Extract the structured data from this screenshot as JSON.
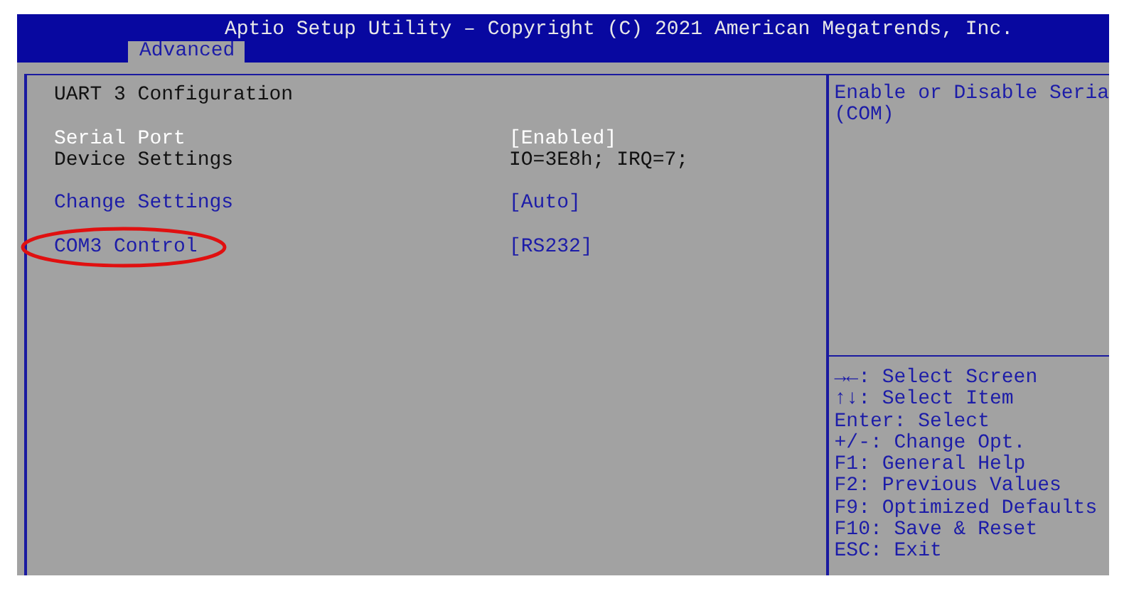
{
  "window": {
    "title": "Aptio Setup Utility – Copyright (C) 2021 American Megatrends, Inc."
  },
  "tabs": [
    {
      "label": "Advanced",
      "selected": true
    }
  ],
  "page_title": "UART 3 Configuration",
  "sections": [
    {
      "items": [
        {
          "kind": "option",
          "label": "Serial Port",
          "value": "[Enabled]",
          "selected": true,
          "circled": false
        },
        {
          "kind": "info",
          "label": "Device Settings",
          "value": "IO=3E8h; IRQ=7;",
          "selected": false,
          "circled": false
        }
      ]
    },
    {
      "items": [
        {
          "kind": "option",
          "label": "Change Settings",
          "value": "[Auto]",
          "selected": false,
          "circled": false
        }
      ]
    },
    {
      "items": [
        {
          "kind": "option",
          "label": "COM3 Control",
          "value": "[RS232]",
          "selected": false,
          "circled": true
        }
      ]
    }
  ],
  "help_text": [
    "Enable or Disable Seria",
    "(COM)"
  ],
  "key_help": [
    "→←: Select Screen",
    "↑↓: Select Item",
    "Enter: Select",
    "+/-: Change Opt.",
    "F1: General Help",
    "F2: Previous Values",
    "F9: Optimized Defaults",
    "F10: Save & Reset",
    "ESC: Exit"
  ]
}
